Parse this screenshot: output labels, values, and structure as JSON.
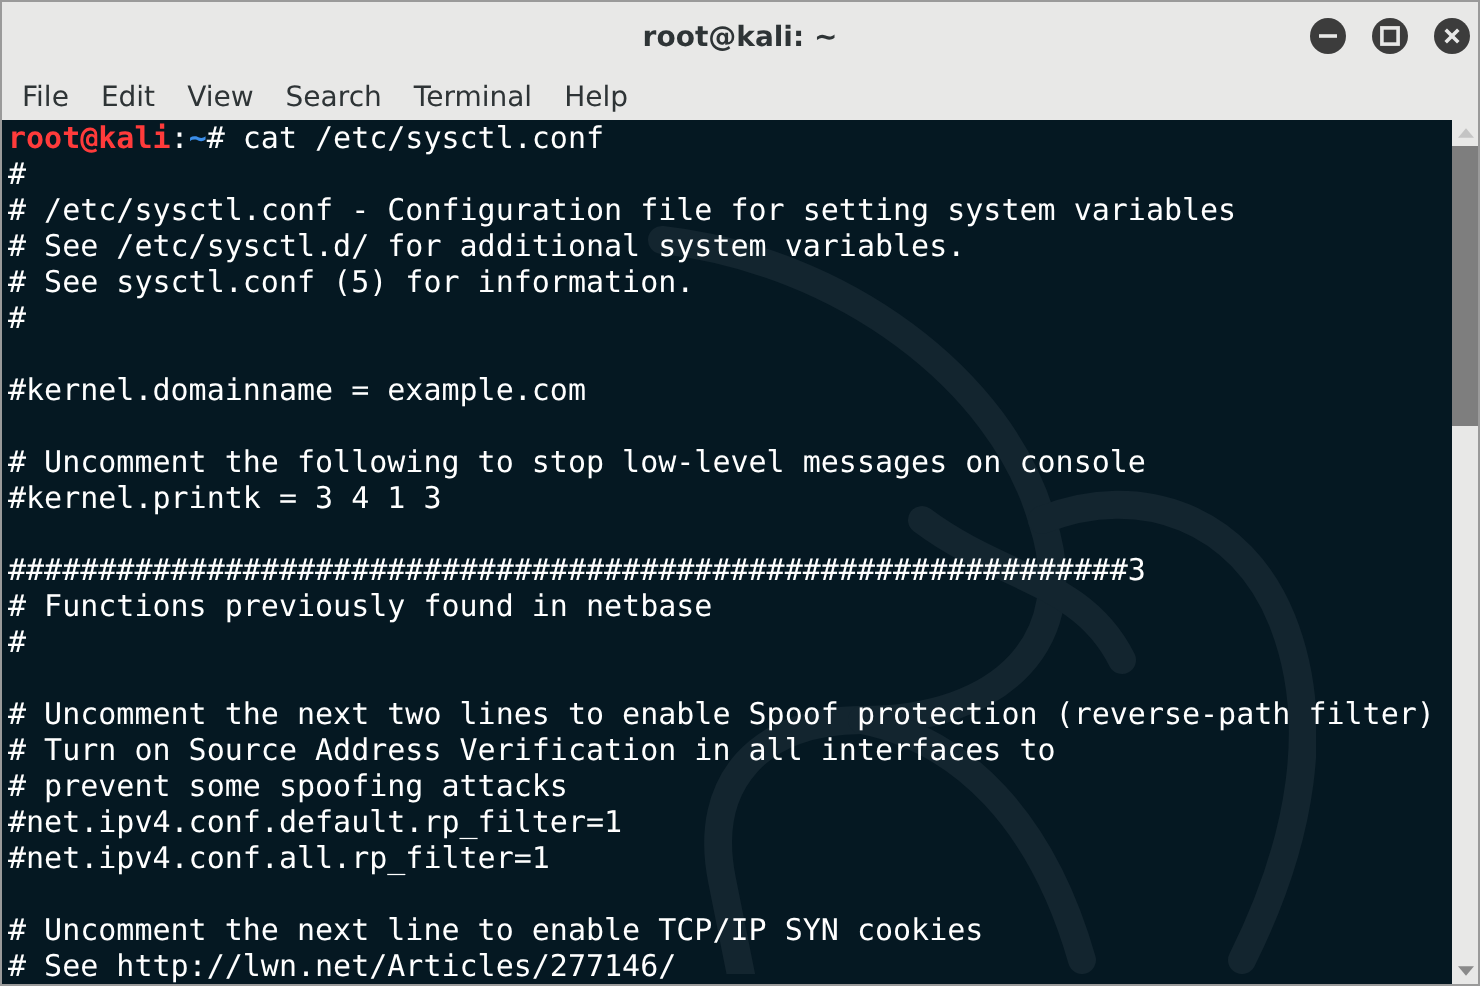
{
  "window": {
    "title": "root@kali: ~"
  },
  "menu": [
    "File",
    "Edit",
    "View",
    "Search",
    "Terminal",
    "Help"
  ],
  "lines": [
    {
      "kind": "prompt",
      "user": "root@kali",
      "sep": ":",
      "path": "~",
      "symbol": "#",
      "command": "cat /etc/sysctl.conf"
    },
    {
      "kind": "text",
      "text": "#"
    },
    {
      "kind": "text",
      "text": "# /etc/sysctl.conf - Configuration file for setting system variables"
    },
    {
      "kind": "text",
      "text": "# See /etc/sysctl.d/ for additional system variables."
    },
    {
      "kind": "text",
      "text": "# See sysctl.conf (5) for information."
    },
    {
      "kind": "text",
      "text": "#"
    },
    {
      "kind": "blank"
    },
    {
      "kind": "text",
      "text": "#kernel.domainname = example.com"
    },
    {
      "kind": "blank"
    },
    {
      "kind": "text",
      "text": "# Uncomment the following to stop low-level messages on console"
    },
    {
      "kind": "text",
      "text": "#kernel.printk = 3 4 1 3"
    },
    {
      "kind": "blank"
    },
    {
      "kind": "text",
      "text": "##############################################################3"
    },
    {
      "kind": "text",
      "text": "# Functions previously found in netbase"
    },
    {
      "kind": "text",
      "text": "#"
    },
    {
      "kind": "blank"
    },
    {
      "kind": "text",
      "text": "# Uncomment the next two lines to enable Spoof protection (reverse-path filter)"
    },
    {
      "kind": "text",
      "text": "# Turn on Source Address Verification in all interfaces to"
    },
    {
      "kind": "text",
      "text": "# prevent some spoofing attacks"
    },
    {
      "kind": "text",
      "text": "#net.ipv4.conf.default.rp_filter=1"
    },
    {
      "kind": "text",
      "text": "#net.ipv4.conf.all.rp_filter=1"
    },
    {
      "kind": "blank"
    },
    {
      "kind": "text",
      "text": "# Uncomment the next line to enable TCP/IP SYN cookies"
    },
    {
      "kind": "text",
      "text": "# See http://lwn.net/Articles/277146/"
    }
  ]
}
